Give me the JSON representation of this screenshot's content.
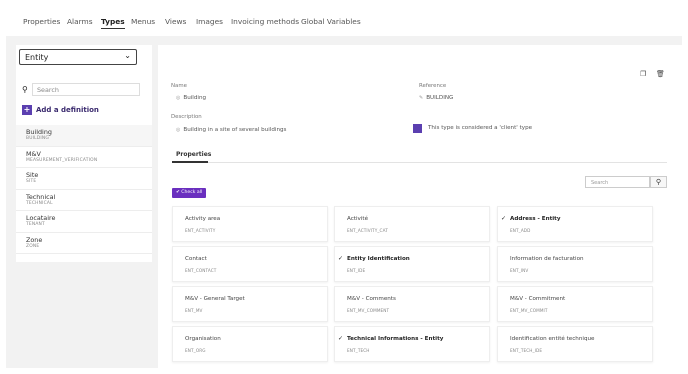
{
  "tabs": [
    "Properties",
    "Alarms",
    "Types",
    "Menus",
    "Views",
    "Images",
    "Invoicing methods",
    "Global Variables"
  ],
  "sidebar": {
    "entity_value": "Entity",
    "search_placeholder": "Search",
    "add_label": "Add a definition",
    "items": [
      {
        "name": "Building",
        "code": "BUILDING"
      },
      {
        "name": "M&V",
        "code": "MEASUREMENT_VERIFICATION"
      },
      {
        "name": "Site",
        "code": "SITE"
      },
      {
        "name": "Technical",
        "code": "TECHNICAL"
      },
      {
        "name": "Locataire",
        "code": "TENANT"
      },
      {
        "name": "Zone",
        "code": "ZONE"
      }
    ]
  },
  "detail": {
    "name_label": "Name",
    "name_value": "Building",
    "reference_label": "Reference",
    "reference_value": "BUILDING",
    "description_label": "Description",
    "description_value": "Building in a site of several buildings",
    "client_type_label": "This type is considered a 'client' type",
    "subtab": "Properties",
    "check_all": "✔ Check all",
    "search_placeholder": "Search"
  },
  "properties": [
    {
      "name": "Activity area",
      "code": "ENT_ACTIVITY",
      "checked": false
    },
    {
      "name": "Activité",
      "code": "ENT_ACTIVITY_CAT",
      "checked": false
    },
    {
      "name": "Address - Entity",
      "code": "ENT_ADD",
      "checked": true
    },
    {
      "name": "Contact",
      "code": "ENT_CONTACT",
      "checked": false
    },
    {
      "name": "Entity Identification",
      "code": "ENT_IDE",
      "checked": true
    },
    {
      "name": "Information de facturation",
      "code": "ENT_INV",
      "checked": false
    },
    {
      "name": "M&V - General Target",
      "code": "ENT_MV",
      "checked": false
    },
    {
      "name": "M&V - Comments",
      "code": "ENT_MV_COMMENT",
      "checked": false
    },
    {
      "name": "M&V - Commitment",
      "code": "ENT_MV_COMMIT",
      "checked": false
    },
    {
      "name": "Organisation",
      "code": "ENT_ORG",
      "checked": false
    },
    {
      "name": "Technical Informations - Entity",
      "code": "ENT_TECH",
      "checked": true
    },
    {
      "name": "Identification entité technique",
      "code": "ENT_TECH_IDE",
      "checked": false
    }
  ],
  "colors": {
    "accent": "#5b3fb0",
    "check_all": "#6a2fbf"
  }
}
